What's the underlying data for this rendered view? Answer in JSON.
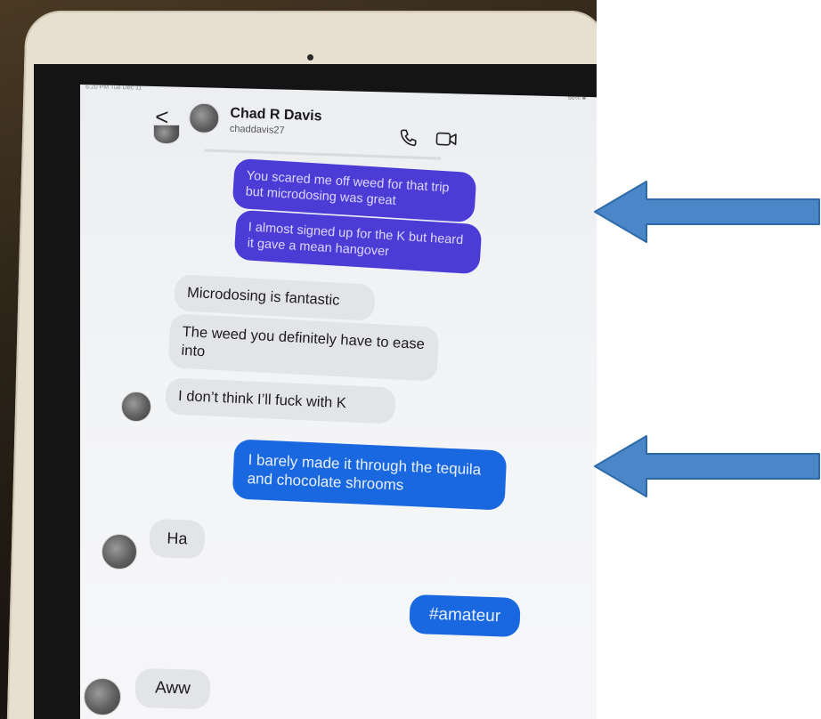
{
  "status_bar": {
    "time": "6:20 PM  Tue Dec 11",
    "battery": "66% ■"
  },
  "header": {
    "back_glyph": "<",
    "contact_name": "Chad R Davis",
    "contact_handle": "chaddavis27",
    "icons": [
      "chevron-left-icon",
      "avatar",
      "phone-icon",
      "video-camera-icon"
    ]
  },
  "messages": [
    {
      "direction": "outgoing",
      "text": "You scared me off weed for that trip but microdosing was great"
    },
    {
      "direction": "outgoing",
      "text": "I almost signed up for the K but heard it gave a mean hangover"
    },
    {
      "direction": "incoming",
      "text": "Microdosing is fantastic"
    },
    {
      "direction": "incoming",
      "text": "The weed you definitely have to ease into"
    },
    {
      "direction": "incoming",
      "text": "I don’t think I’ll fuck with K"
    },
    {
      "direction": "outgoing",
      "text": "I barely made it through the tequila and chocolate shrooms"
    },
    {
      "direction": "incoming",
      "text": "Ha"
    },
    {
      "direction": "outgoing",
      "text": "#amateur"
    },
    {
      "direction": "incoming",
      "text": "Aww"
    }
  ],
  "colors": {
    "outgoing_purple": "#4b3cd6",
    "outgoing_blue": "#1a68e0",
    "incoming_gray": "#e3e4e8",
    "arrow_blue": "#4a86c8"
  },
  "annotations": [
    "arrow-left-icon",
    "arrow-left-icon"
  ]
}
